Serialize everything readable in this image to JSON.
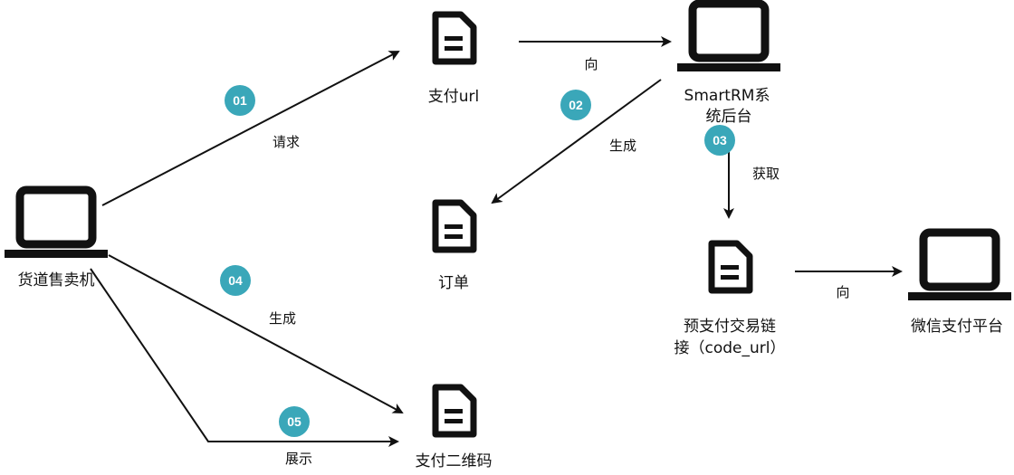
{
  "colors": {
    "stroke": "#111111",
    "badge": "#3aa7b9",
    "badge_text": "#ffffff",
    "background": "#ffffff"
  },
  "nodes": {
    "vending_machine": {
      "label": "货道售卖机",
      "icon": "laptop-icon"
    },
    "pay_url": {
      "label": "支付url",
      "icon": "document-icon"
    },
    "smartrm": {
      "label_line1": "SmartRM系",
      "label_line2": "统后台",
      "icon": "laptop-icon"
    },
    "order": {
      "label": "订单",
      "icon": "document-icon"
    },
    "prepay_link": {
      "label_line1": "预支付交易链",
      "label_line2": "接（code_url）",
      "icon": "document-icon"
    },
    "wechat_pay": {
      "label": "微信支付平台",
      "icon": "laptop-icon"
    },
    "qrcode": {
      "label": "支付二维码",
      "icon": "document-icon"
    }
  },
  "edges": {
    "request": {
      "label": "请求",
      "step": "01"
    },
    "to_backend": {
      "label": "向"
    },
    "generate_order": {
      "label": "生成",
      "step": "02"
    },
    "obtain": {
      "label": "获取",
      "step": "03"
    },
    "to_wechat": {
      "label": "向"
    },
    "generate_qrcode": {
      "label": "生成",
      "step": "04"
    },
    "display": {
      "label": "展示",
      "step": "05"
    }
  }
}
